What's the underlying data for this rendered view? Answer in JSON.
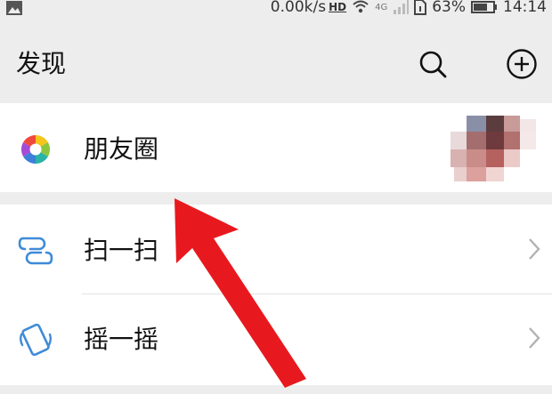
{
  "status_bar": {
    "network_speed": "0.00k/s",
    "hd_badge": "HD",
    "signal_label": "4G",
    "battery": "63%",
    "time": "14:14",
    "icons": [
      "image-icon",
      "wifi-icon",
      "signal-icon",
      "sim-icon",
      "battery-icon"
    ]
  },
  "header": {
    "title": "发现",
    "actions": [
      "search-icon",
      "add-circle-icon"
    ]
  },
  "sections": [
    {
      "items": [
        {
          "label": "朋友圈",
          "icon": "moments-icon",
          "has_thumbnail": true
        }
      ]
    },
    {
      "items": [
        {
          "label": "扫一扫",
          "icon": "scan-icon",
          "chevron": true
        },
        {
          "label": "摇一摇",
          "icon": "shake-icon",
          "chevron": true
        }
      ]
    }
  ],
  "annotation": {
    "icon": "red-arrow-icon",
    "color": "#e8191e"
  },
  "colors": {
    "background": "#ededed",
    "card": "#ffffff",
    "scan_icon": "#3f8bd8",
    "chevron": "#b2b2b2"
  }
}
